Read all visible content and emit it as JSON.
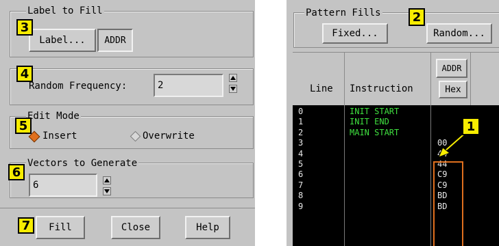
{
  "left": {
    "label_to_fill": {
      "title": "Label to Fill",
      "label_button": "Label...",
      "label_value": "ADDR"
    },
    "random_frequency": {
      "label": "Random Frequency:",
      "value": "2"
    },
    "edit_mode": {
      "title": "Edit Mode",
      "insert_label": "Insert",
      "overwrite_label": "Overwrite",
      "selected": "Insert"
    },
    "vectors": {
      "title": "Vectors to Generate",
      "value": "6"
    },
    "buttons": {
      "fill": "Fill",
      "close": "Close",
      "help": "Help"
    }
  },
  "right": {
    "pattern_fills": {
      "title": "Pattern Fills",
      "fixed": "Fixed...",
      "random": "Random..."
    },
    "columns": {
      "line": "Line",
      "instruction": "Instruction",
      "addr_label": "ADDR",
      "addr_base": "Hex"
    },
    "rows": [
      {
        "line": "0",
        "instruction": "INIT START",
        "addr": ""
      },
      {
        "line": "1",
        "instruction": "INIT END",
        "addr": ""
      },
      {
        "line": "2",
        "instruction": "MAIN START",
        "addr": ""
      },
      {
        "line": "3",
        "instruction": "",
        "addr": "00"
      },
      {
        "line": "4",
        "instruction": "",
        "addr": "44"
      },
      {
        "line": "5",
        "instruction": "",
        "addr": "44"
      },
      {
        "line": "6",
        "instruction": "",
        "addr": "C9"
      },
      {
        "line": "7",
        "instruction": "",
        "addr": "C9"
      },
      {
        "line": "8",
        "instruction": "",
        "addr": "BD"
      },
      {
        "line": "9",
        "instruction": "",
        "addr": "BD"
      }
    ]
  },
  "callouts": {
    "c1": "1",
    "c2": "2",
    "c3": "3",
    "c4": "4",
    "c5": "5",
    "c6": "6",
    "c7": "7"
  },
  "colors": {
    "panel": "#c4c4c4",
    "callout": "#f7ec00",
    "instruction_text": "#3fe03f",
    "list_bg": "#000000",
    "highlight": "#e0701e"
  }
}
